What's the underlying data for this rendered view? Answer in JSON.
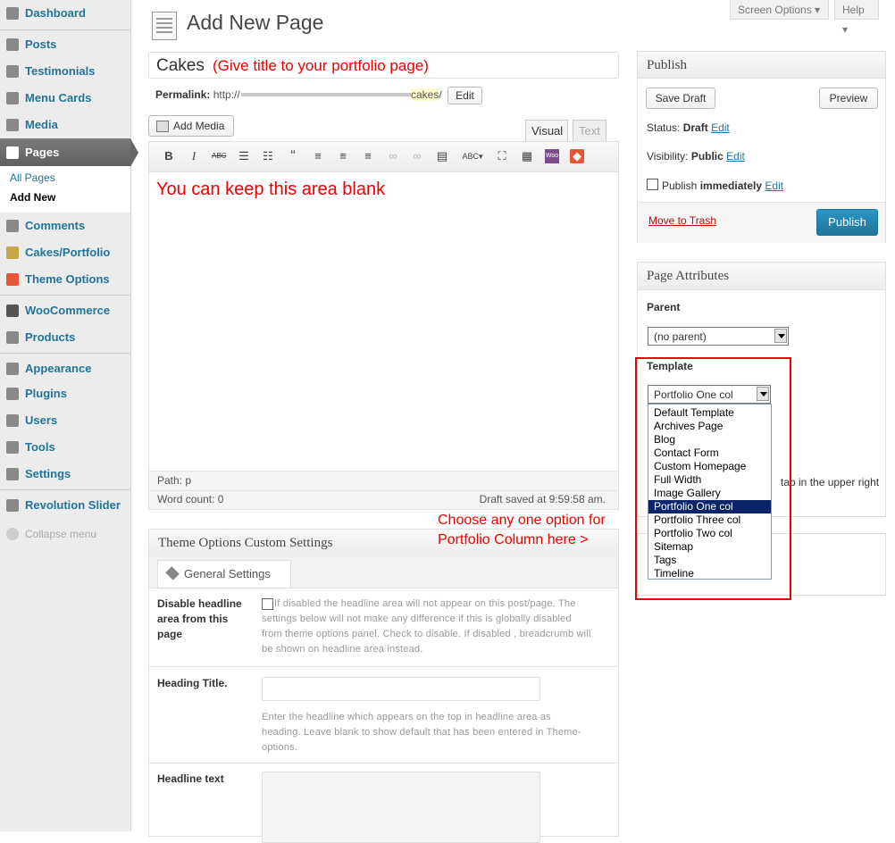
{
  "top_buttons": {
    "screen_options": "Screen Options ▾",
    "help": "Help ▾"
  },
  "sidebar": {
    "items": [
      {
        "label": "Dashboard",
        "icon": "dashboard-icon"
      },
      {
        "label": "Posts",
        "icon": "pin-icon"
      },
      {
        "label": "Testimonials",
        "icon": "thumb-icon"
      },
      {
        "label": "Menu Cards",
        "icon": "card-icon"
      },
      {
        "label": "Media",
        "icon": "media-icon"
      },
      {
        "label": "Pages",
        "icon": "pages-icon"
      },
      {
        "label": "Comments",
        "icon": "comment-icon"
      },
      {
        "label": "Cakes/Portfolio",
        "icon": "brush-icon"
      },
      {
        "label": "Theme Options",
        "icon": "theme-icon"
      },
      {
        "label": "WooCommerce",
        "icon": "woo-icon"
      },
      {
        "label": "Products",
        "icon": "cart-icon"
      },
      {
        "label": "Appearance",
        "icon": "appearance-icon"
      },
      {
        "label": "Plugins",
        "icon": "plugin-icon"
      },
      {
        "label": "Users",
        "icon": "users-icon"
      },
      {
        "label": "Tools",
        "icon": "tools-icon"
      },
      {
        "label": "Settings",
        "icon": "settings-icon"
      },
      {
        "label": "Revolution Slider",
        "icon": "gear-icon"
      }
    ],
    "pages_sub": {
      "all_pages": "All Pages",
      "add_new": "Add New"
    },
    "collapse": "Collapse menu"
  },
  "header": {
    "title": "Add New Page"
  },
  "title_field": {
    "value": "Cakes",
    "hint": "(Give title to your portfolio page)"
  },
  "permalink": {
    "label": "Permalink:",
    "prefix": "http://",
    "slug": "cakes",
    "suffix": "/",
    "edit": "Edit"
  },
  "editor": {
    "add_media": "Add Media",
    "tab_visual": "Visual",
    "tab_text": "Text",
    "content_hint": "You can keep this area blank",
    "path": "Path: p",
    "word_count": "Word count: 0",
    "draft_saved": "Draft saved at 9:59:58 am."
  },
  "theme_options": {
    "title": "Theme Options Custom Settings",
    "tab": "General Settings",
    "disable_label": "Disable headline area from this page",
    "disable_desc": "If disabled the headline area will not appear on this post/page. The settings below will not make any difference if this is globally disabled from theme options panel. Check to disable. If disabled , breadcrumb will be shown on headline area instead.",
    "heading_label": "Heading Title.",
    "heading_desc": "Enter the headline which appears on the top in headline area as heading. Leave blank to show default that has been entered in Theme-options.",
    "headline_text_label": "Headline text"
  },
  "publish": {
    "title": "Publish",
    "save_draft": "Save Draft",
    "preview": "Preview",
    "status_label": "Status:",
    "status_value": "Draft",
    "visibility_label": "Visibility:",
    "visibility_value": "Public",
    "publish_label": "Publish",
    "publish_value": "immediately",
    "edit": "Edit",
    "move_trash": "Move to Trash",
    "publish_btn": "Publish"
  },
  "page_attributes": {
    "title": "Page Attributes",
    "parent_label": "Parent",
    "parent_value": "(no parent)",
    "template_label": "Template",
    "template_value": "Portfolio One col",
    "template_options": [
      "Default Template",
      "Archives Page",
      "Blog",
      "Contact Form",
      "Custom Homepage",
      "Full Width",
      "Image Gallery",
      "Portfolio One col",
      "Portfolio Three col",
      "Portfolio Two col",
      "Sitemap",
      "Tags",
      "Timeline"
    ],
    "selected_index": 7,
    "help_fragment": "tab in the upper right"
  },
  "annotation": {
    "line1": "Choose any one option for",
    "line2": "Portfolio Column here >"
  },
  "colors": {
    "link": "#21759b",
    "annotation": "#ee0000",
    "publish_btn": "#21759b",
    "selected_option": "#0a246a"
  }
}
